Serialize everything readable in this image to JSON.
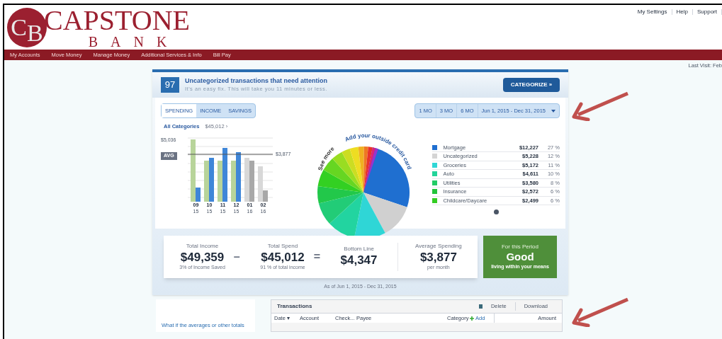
{
  "logo": {
    "initials_1": "C",
    "initials_2": "B",
    "name": "CAPSTONE",
    "subname": "BANK"
  },
  "top_links": [
    "My Settings",
    "Help",
    "Support"
  ],
  "nav": [
    "My Accounts",
    "Move Money",
    "Manage Money",
    "Additional Services & Info",
    "Bill Pay"
  ],
  "last_visit": "Last Visit: Feb",
  "alert": {
    "count": "97",
    "title": "Uncategorized transactions that need attention",
    "subtitle": "It's an easy fix. This will take you 11 minutes or less.",
    "button": "CATEGORIZE »"
  },
  "view_tabs": [
    {
      "label": "SPENDING",
      "selected": true
    },
    {
      "label": "INCOME",
      "selected": false
    },
    {
      "label": "SAVINGS",
      "selected": false
    }
  ],
  "period_buttons": [
    "1 MO",
    "3 MO",
    "6 MO"
  ],
  "date_range": "Jun 1, 2015 - Dec 31, 2015",
  "category_filter": {
    "label": "All Categories",
    "amount": "$45,012 ›"
  },
  "bar_chart": {
    "top_label": "$5,036",
    "avg_tag": "AVG",
    "avg_label": "$3,877",
    "months": [
      {
        "month": "09",
        "year": "15"
      },
      {
        "month": "10",
        "year": "15"
      },
      {
        "month": "11",
        "year": "15"
      },
      {
        "month": "12",
        "year": "15"
      },
      {
        "month": "01",
        "year": "16"
      },
      {
        "month": "02",
        "year": "16"
      }
    ]
  },
  "pie": {
    "see_more": "See more",
    "add_card": "Add your outside credit card"
  },
  "legend": [
    {
      "name": "Mortgage",
      "amount": "$12,227",
      "percent": "27 %",
      "color": "#1f6fd0"
    },
    {
      "name": "Uncategorized",
      "amount": "$5,228",
      "percent": "12 %",
      "color": "#d4d4d4"
    },
    {
      "name": "Groceries",
      "amount": "$5,172",
      "percent": "11 %",
      "color": "#2fd6d6"
    },
    {
      "name": "Auto",
      "amount": "$4,611",
      "percent": "10 %",
      "color": "#22d49a"
    },
    {
      "name": "Utilities",
      "amount": "$3,580",
      "percent": "8 %",
      "color": "#22cc66"
    },
    {
      "name": "Insurance",
      "amount": "$2,572",
      "percent": "6 %",
      "color": "#22c43a"
    },
    {
      "name": "Childcare/Daycare",
      "amount": "$2,499",
      "percent": "6 %",
      "color": "#33cc22"
    }
  ],
  "summary": [
    {
      "label": "Total Income",
      "value": "$49,359",
      "note": "3% of Income Saved"
    },
    {
      "label": "Total Spend",
      "value": "$45,012",
      "note": "91 % of total income"
    },
    {
      "label": "Bottom Line",
      "value": "$4,347"
    },
    {
      "label": "Average Spending",
      "value": "$3,877",
      "note": "per month"
    }
  ],
  "operators": [
    "–",
    "="
  ],
  "verdict": {
    "heading": "For this Period",
    "value": "Good",
    "note": "living within your means"
  },
  "as_of": "As of Jun 1, 2015 - Dec 31, 2015",
  "side_link": "What if the averages or other totals",
  "transactions": {
    "title": "Transactions",
    "delete": "Delete",
    "download": "Download",
    "columns": [
      "Date ▾",
      "Account",
      "Check...",
      "Payee",
      "Category",
      "Add",
      "",
      "Amount"
    ]
  }
}
